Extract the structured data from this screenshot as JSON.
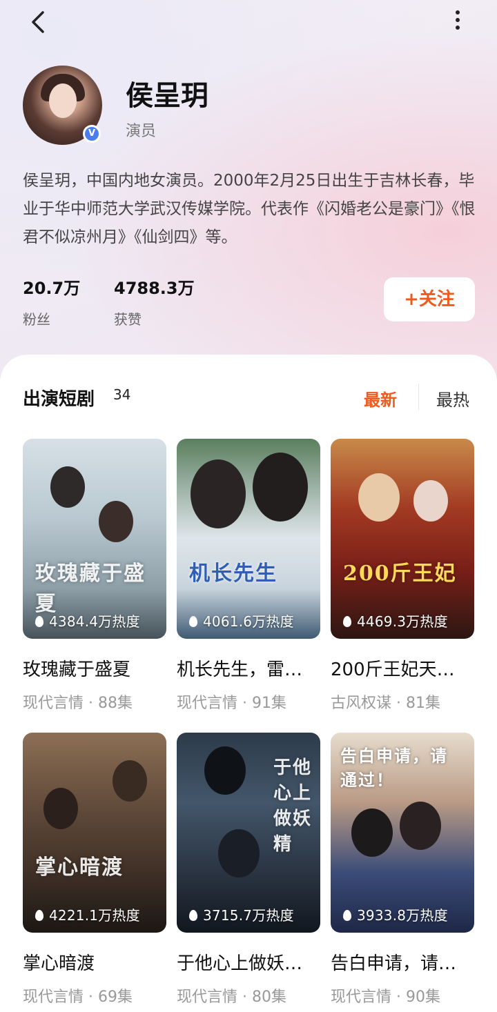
{
  "header": {
    "back_icon": "chevron-left-icon",
    "more_icon": "more-vertical-icon"
  },
  "profile": {
    "name": "侯呈玥",
    "role": "演员",
    "verified_badge": "V",
    "bio": "侯呈玥，中国内地女演员。2000年2月25日出生于吉林长春，毕业于华中师范大学武汉传媒学院。代表作《闪婚老公是豪门》《恨君不似凉州月》《仙剑四》等。",
    "stats": [
      {
        "value": "20.7万",
        "label": "粉丝"
      },
      {
        "value": "4788.3万",
        "label": "获赞"
      }
    ],
    "follow_label": "+关注"
  },
  "section": {
    "title": "出演短剧",
    "count": "34",
    "sort_new": "最新",
    "sort_hot": "最热"
  },
  "dramas": [
    {
      "title": "玫瑰藏于盛夏",
      "meta": "现代言情 · 88集",
      "heat": "4384.4万热度",
      "poster_text": "玫瑰藏于盛夏"
    },
    {
      "title": "机长先生，雷…",
      "meta": "现代言情 · 91集",
      "heat": "4061.6万热度",
      "poster_text": "机长先生"
    },
    {
      "title": "200斤王妃天…",
      "meta": "古风权谋 · 81集",
      "heat": "4469.3万热度",
      "poster_text": "200斤王妃"
    },
    {
      "title": "掌心暗渡",
      "meta": "现代言情 · 69集",
      "heat": "4221.1万热度",
      "poster_text": "掌心暗渡"
    },
    {
      "title": "于他心上做妖…",
      "meta": "现代言情 · 80集",
      "heat": "3715.7万热度",
      "poster_text": "于他心上做妖精"
    },
    {
      "title": "告白申请，请…",
      "meta": "现代言情 · 90集",
      "heat": "3933.8万热度",
      "poster_text": "告白申请，请通过！"
    }
  ],
  "colors": {
    "accent": "#f05a1e",
    "verified": "#4a7ef0"
  }
}
